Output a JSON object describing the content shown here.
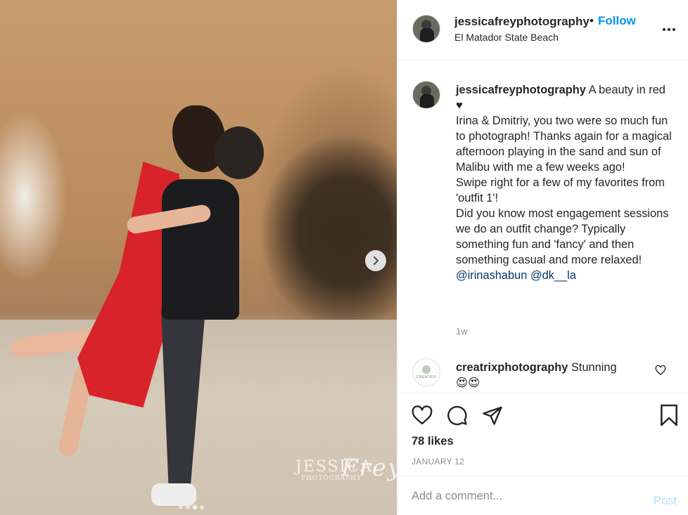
{
  "photo": {
    "alt": "",
    "watermark_main": "JESSICA",
    "watermark_script": "Frey",
    "watermark_sub": "PHOTOGRAPHY",
    "carousel_dots": 4,
    "carousel_active_index": 2
  },
  "header": {
    "username": "jessicafreyphotography",
    "separator": "•",
    "follow_label": "Follow",
    "location": "El Matador State Beach",
    "more_icon": "more-horizontal-icon"
  },
  "caption": {
    "username": "jessicafreyphotography",
    "lines": [
      "A beauty in red ♥",
      "Irina & Dmitriy, you two were so much fun to photograph! Thanks again for a magical afternoon playing in the sand and sun of Malibu with me a few weeks ago!",
      "Swipe right for a few of my favorites from 'outfit 1'!",
      "Did you know most engagement sessions we do an outfit change? Typically something fun and 'fancy' and then something casual and more relaxed!"
    ],
    "mention_1": "@irinashabun",
    "mention_2": "@dk__la",
    "time": "1w"
  },
  "comment": {
    "username": "creatrixphotography",
    "text": "Stunning",
    "emoji": "😍😍",
    "avatar_text": "CREATRIX"
  },
  "actions": {
    "likes": "78 likes",
    "date": "JANUARY 12"
  },
  "add_comment": {
    "placeholder": "Add a comment...",
    "post_label": "Post"
  },
  "colors": {
    "accent": "#0095f6",
    "post_disabled": "#b2dffc",
    "mention": "#00376b",
    "muted": "#8e8e8e"
  }
}
